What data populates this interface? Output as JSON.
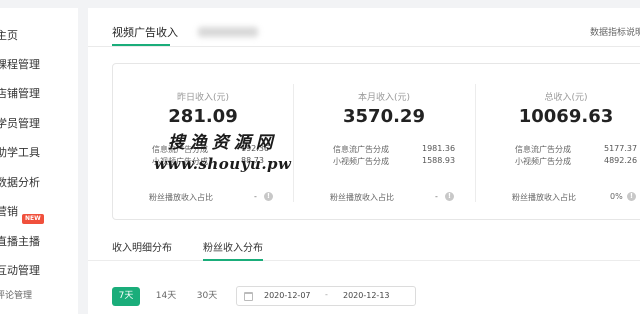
{
  "sidebar": {
    "items": [
      "主页",
      "课程管理",
      "店铺管理",
      "学员管理",
      "助学工具",
      "数据分析",
      "营销",
      "直播主播",
      "互动管理",
      "评论管理"
    ],
    "new_badge": "NEW"
  },
  "header": {
    "active_tab": "视频广告收入",
    "doc_link": "数据指标说明"
  },
  "stats": [
    {
      "label": "昨日收入(元)",
      "value": "281.09",
      "feed_label": "信息流广告分成",
      "feed_value": "192.36",
      "short_label": "小视频广告分成",
      "short_value": "88.73",
      "fans_label": "粉丝播放收入占比",
      "fans_value": "-"
    },
    {
      "label": "本月收入(元)",
      "value": "3570.29",
      "feed_label": "信息流广告分成",
      "feed_value": "1981.36",
      "short_label": "小视频广告分成",
      "short_value": "1588.93",
      "fans_label": "粉丝播放收入占比",
      "fans_value": "-"
    },
    {
      "label": "总收入(元)",
      "value": "10069.63",
      "feed_label": "信息流广告分成",
      "feed_value": "5177.37",
      "short_label": "小视频广告分成",
      "short_value": "4892.26",
      "fans_label": "粉丝播放收入占比",
      "fans_value": "0%"
    }
  ],
  "watermark": {
    "line1": "搜渔资源网",
    "line2": "www.shouyu.pw"
  },
  "subtabs": [
    "收入明细分布",
    "粉丝收入分布"
  ],
  "ranges": [
    "7天",
    "14天",
    "30天"
  ],
  "date_range": {
    "start": "2020-12-07",
    "separator": "-",
    "end": "2020-12-13"
  },
  "colors": {
    "accent": "#1aad7a",
    "badge": "#f0503c"
  }
}
